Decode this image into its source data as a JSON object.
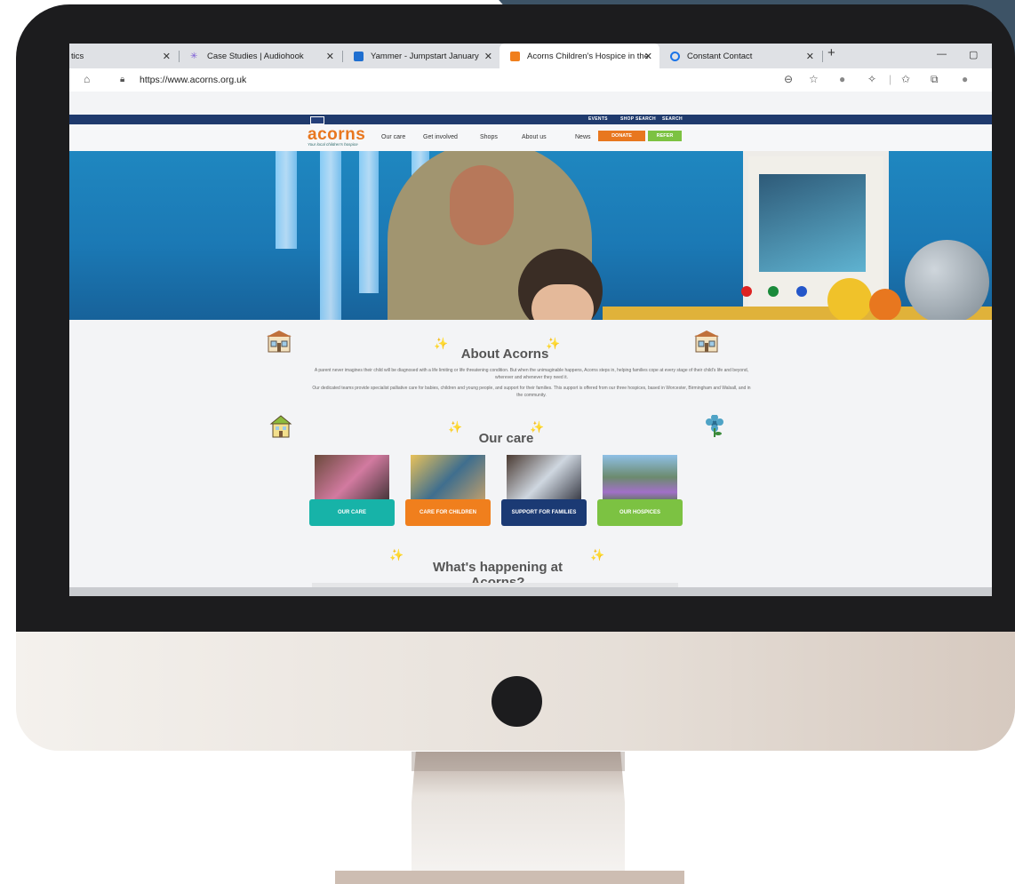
{
  "browser": {
    "tabs": [
      {
        "label": "tics",
        "icon": "analytics-icon",
        "active": false
      },
      {
        "label": "Case Studies | Audiohook",
        "icon": "audiohook-icon",
        "active": false
      },
      {
        "label": "Yammer - Jumpstart January",
        "icon": "yammer-icon",
        "active": false
      },
      {
        "label": "Acorns Children's Hospice in the",
        "icon": "acorns-favicon",
        "active": true
      },
      {
        "label": "Constant Contact",
        "icon": "constant-contact-icon",
        "active": false
      }
    ],
    "new_tab": "+",
    "minimize": "—",
    "restore": "▢",
    "url": "https://www.acorns.org.uk"
  },
  "site": {
    "top_links": [
      "EVENTS",
      "SHOP SEARCH",
      "SEARCH"
    ],
    "logo": "acorns",
    "tagline": "Your local children's hospice",
    "nav": [
      "Our care",
      "Get involved",
      "Shops",
      "About us",
      "News"
    ],
    "donate_label": "DONATE",
    "refer_label": "REFER",
    "colors": {
      "navy": "#1f3a6d",
      "orange": "#e8771f",
      "green": "#7cc242",
      "teal": "#17b3a8",
      "dark_blue": "#1b3a74"
    }
  },
  "about": {
    "title": "About Acorns",
    "para1": "A parent never imagines their child will be diagnosed with a life limiting or life threatening condition. But when the unimaginable happens, Acorns steps in, helping families cope at every stage of their child's life and beyond, wherever and whenever they need it.",
    "para2": "Our dedicated teams provide specialist palliative care for babies, children and young people, and support for their families. This support is offered from our three hospices, based in Worcester, Birmingham and Walsall, and in the community."
  },
  "our_care": {
    "title": "Our care",
    "cards": [
      {
        "label": "OUR CARE",
        "color": "#17b3a8"
      },
      {
        "label": "CARE FOR CHILDREN",
        "color": "#f07f1d"
      },
      {
        "label": "SUPPORT FOR FAMILIES",
        "color": "#1b3a74"
      },
      {
        "label": "OUR HOSPICES",
        "color": "#7cc242"
      }
    ]
  },
  "happening": {
    "title": "What's happening at Acorns?"
  }
}
